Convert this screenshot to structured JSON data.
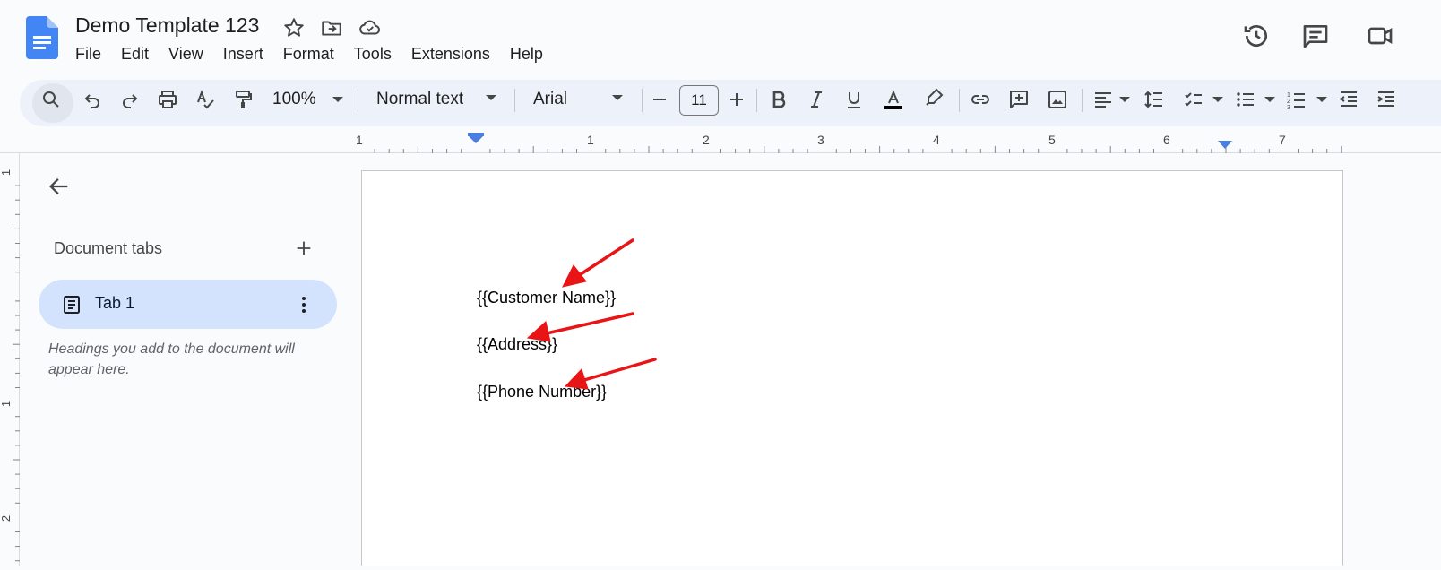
{
  "app": {
    "title": "Demo Template 123",
    "menu": [
      "File",
      "Edit",
      "View",
      "Insert",
      "Format",
      "Tools",
      "Extensions",
      "Help"
    ]
  },
  "toolbar": {
    "zoom": "100%",
    "style": "Normal text",
    "font": "Arial",
    "font_size": "11",
    "text_color": "#000000"
  },
  "ruler": {
    "h_labels": [
      "1",
      "1",
      "2",
      "3",
      "4",
      "5",
      "6",
      "7"
    ],
    "v_labels": [
      "1",
      "1",
      "2"
    ]
  },
  "sidebar": {
    "heading": "Document tabs",
    "tab_label": "Tab 1",
    "hint": "Headings you add to the document will appear here."
  },
  "document": {
    "lines": [
      "{{Customer Name}}",
      "{{Address}}",
      "{{Phone Number}}"
    ]
  },
  "colors": {
    "accent": "#1a73e8",
    "annotation_arrow": "#e81416",
    "tab_active_bg": "#d3e3fd",
    "toolbar_bg": "#edf2fa"
  }
}
